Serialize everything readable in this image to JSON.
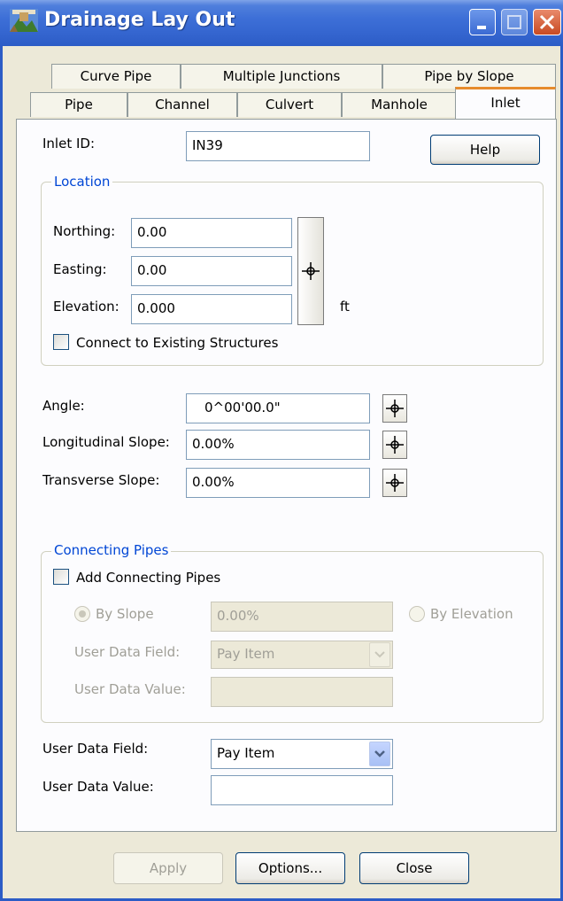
{
  "window": {
    "title": "Drainage Lay Out"
  },
  "tabs_row1": [
    "Curve Pipe",
    "Multiple Junctions",
    "Pipe by Slope"
  ],
  "tabs_row2": [
    "Pipe",
    "Channel",
    "Culvert",
    "Manhole",
    "Inlet"
  ],
  "active_tab": "Inlet",
  "inlet": {
    "id_label": "Inlet ID:",
    "id_value": "IN39",
    "help_label": "Help"
  },
  "location": {
    "legend": "Location",
    "northing_label": "Northing:",
    "northing_value": "0.00",
    "easting_label": "Easting:",
    "easting_value": "0.00",
    "elevation_label": "Elevation:",
    "elevation_value": "0.000",
    "unit": "ft",
    "connect_label": "Connect to Existing Structures"
  },
  "orientation": {
    "angle_label": "Angle:",
    "angle_value": "0^00'00.0\"",
    "long_slope_label": "Longitudinal Slope:",
    "long_slope_value": "0.00%",
    "trans_slope_label": "Transverse Slope:",
    "trans_slope_value": "0.00%"
  },
  "connecting_pipes": {
    "legend": "Connecting Pipes",
    "add_label": "Add Connecting Pipes",
    "by_slope_label": "By Slope",
    "slope_value": "0.00%",
    "by_elevation_label": "By Elevation",
    "udf_label": "User Data Field:",
    "udf_value": "Pay Item",
    "udv_label": "User Data Value:",
    "udv_value": ""
  },
  "user_data": {
    "field_label": "User Data Field:",
    "field_value": "Pay Item",
    "value_label": "User Data Value:",
    "value_value": ""
  },
  "buttons": {
    "apply": "Apply",
    "options": "Options...",
    "close": "Close"
  }
}
